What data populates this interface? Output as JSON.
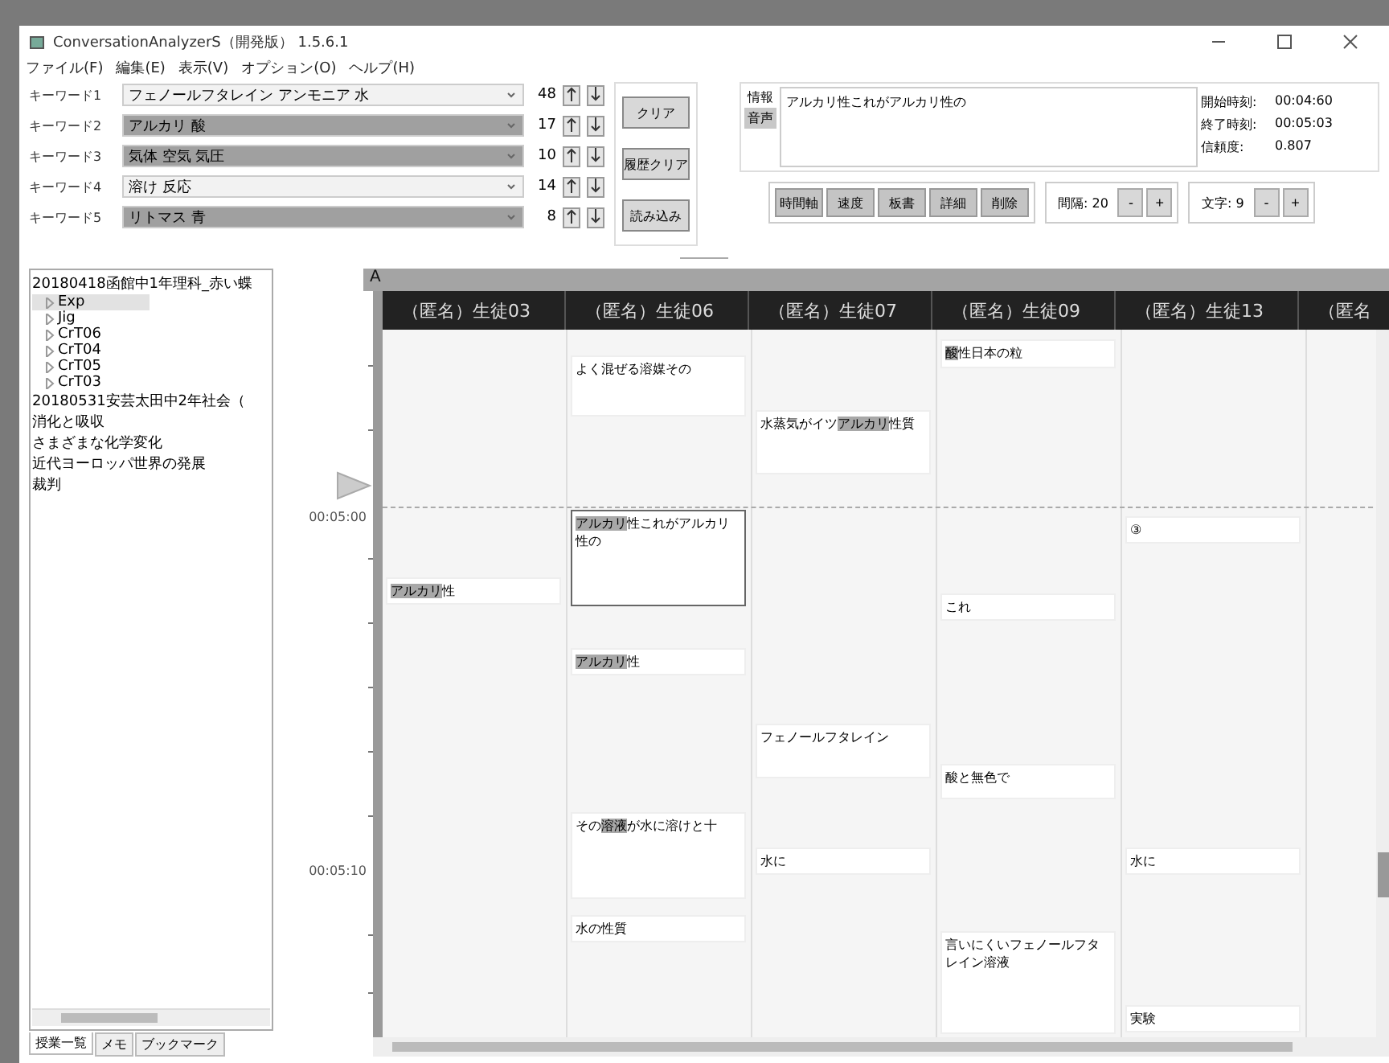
{
  "window": {
    "title": "ConversationAnalyzerS（開発版） 1.5.6.1"
  },
  "menu": [
    "ファイル(F)",
    "編集(E)",
    "表示(V)",
    "オプション(O)",
    "ヘルプ(H)"
  ],
  "keywords": [
    {
      "label": "キーワード1",
      "value": "フェノールフタレイン アンモニア 水",
      "highlighted": false,
      "count": "48"
    },
    {
      "label": "キーワード2",
      "value": "アルカリ 酸",
      "highlighted": true,
      "count": "17"
    },
    {
      "label": "キーワード3",
      "value": "気体 空気 気圧",
      "highlighted": true,
      "count": "10"
    },
    {
      "label": "キーワード4",
      "value": "溶け 反応",
      "highlighted": false,
      "count": "14"
    },
    {
      "label": "キーワード5",
      "value": "リトマス 青",
      "highlighted": true,
      "count": "8"
    }
  ],
  "keyword_buttons": [
    "クリア",
    "履歴クリア",
    "読み込み"
  ],
  "info": {
    "tabs": [
      {
        "label": "情報",
        "selected": false
      },
      {
        "label": "音声",
        "selected": true
      }
    ],
    "text": "アルカリ性これがアルカリ性の",
    "stats": [
      {
        "label": "開始時刻:",
        "value": "00:04:60"
      },
      {
        "label": "終了時刻:",
        "value": "00:05:03"
      },
      {
        "label": "信頼度:",
        "value": "0.807"
      }
    ]
  },
  "view_buttons": [
    "時間軸",
    "速度",
    "板書",
    "詳細",
    "削除"
  ],
  "spacing": {
    "label": "間隔:",
    "value": "20",
    "minus": "-",
    "plus": "+"
  },
  "font_size": {
    "label": "文字:",
    "value": "9",
    "minus": "-",
    "plus": "+"
  },
  "tree": [
    {
      "label": "20180418函館中1年理科_赤い蝶",
      "selected": false,
      "children": [
        {
          "label": "Exp",
          "selected": true,
          "expanded": false
        },
        {
          "label": "Jig",
          "selected": false,
          "expanded": false
        },
        {
          "label": "CrT06",
          "selected": false,
          "expanded": false
        },
        {
          "label": "CrT04",
          "selected": false,
          "expanded": false
        },
        {
          "label": "CrT05",
          "selected": false,
          "expanded": false
        },
        {
          "label": "CrT03",
          "selected": false,
          "expanded": false
        }
      ]
    },
    {
      "label": "20180531安芸太田中2年社会（",
      "selected": false
    },
    {
      "label": "消化と吸収",
      "selected": false
    },
    {
      "label": "さまざまな化学変化",
      "selected": false
    },
    {
      "label": "近代ヨーロッパ世界の発展",
      "selected": false
    },
    {
      "label": "裁判",
      "selected": false
    }
  ],
  "bottom_tabs": [
    {
      "label": "授業一覧",
      "selected": true
    },
    {
      "label": "メモ",
      "selected": false
    },
    {
      "label": "ブックマーク",
      "selected": false
    }
  ],
  "timeline": {
    "group": "A",
    "times": [
      "00:05:00",
      "00:05:10"
    ],
    "columns": [
      {
        "name": "（匿名）生徒03",
        "cards": [
          {
            "selected": false,
            "segments": [
              {
                "text": "アルカリ",
                "highlight": true
              },
              {
                "text": "性",
                "highlight": false
              }
            ]
          }
        ]
      },
      {
        "name": "（匿名）生徒06",
        "cards": [
          {
            "selected": false,
            "segments": [
              {
                "text": "よく混ぜる溶媒その",
                "highlight": false
              }
            ]
          },
          {
            "selected": true,
            "segments": [
              {
                "text": "アルカリ",
                "highlight": true
              },
              {
                "text": "性これがアルカリ性の",
                "highlight": false
              }
            ]
          },
          {
            "selected": false,
            "segments": [
              {
                "text": "アルカリ",
                "highlight": true
              },
              {
                "text": "性",
                "highlight": false
              }
            ]
          },
          {
            "selected": false,
            "segments": [
              {
                "text": "その",
                "highlight": false
              },
              {
                "text": "溶液",
                "highlight": true
              },
              {
                "text": "が水に溶けと十",
                "highlight": false
              }
            ]
          },
          {
            "selected": false,
            "segments": [
              {
                "text": "水の性質",
                "highlight": false
              }
            ]
          }
        ]
      },
      {
        "name": "（匿名）生徒07",
        "cards": [
          {
            "selected": false,
            "segments": [
              {
                "text": "水蒸気がイツ",
                "highlight": false
              },
              {
                "text": "アルカリ",
                "highlight": true
              },
              {
                "text": "性質",
                "highlight": false
              }
            ]
          },
          {
            "selected": false,
            "segments": [
              {
                "text": "フェノールフタレイン",
                "highlight": false
              }
            ]
          },
          {
            "selected": false,
            "segments": [
              {
                "text": "水に",
                "highlight": false
              }
            ]
          }
        ]
      },
      {
        "name": "（匿名）生徒09",
        "cards": [
          {
            "selected": false,
            "segments": [
              {
                "text": "酸",
                "highlight": true
              },
              {
                "text": "性日本の粒",
                "highlight": false
              }
            ]
          },
          {
            "selected": false,
            "segments": [
              {
                "text": "これ",
                "highlight": false
              }
            ]
          },
          {
            "selected": false,
            "segments": [
              {
                "text": "酸と無色で",
                "highlight": false
              }
            ]
          },
          {
            "selected": false,
            "segments": [
              {
                "text": "言いにくいフェノールフタレイン溶液",
                "highlight": false
              }
            ]
          }
        ]
      },
      {
        "name": "（匿名）生徒13",
        "cards": [
          {
            "selected": false,
            "segments": [
              {
                "text": "③",
                "highlight": false
              }
            ]
          },
          {
            "selected": false,
            "segments": [
              {
                "text": "水に",
                "highlight": false
              }
            ]
          },
          {
            "selected": false,
            "segments": [
              {
                "text": "実験",
                "highlight": false
              }
            ]
          }
        ]
      },
      {
        "name": "（匿名"
      }
    ]
  }
}
